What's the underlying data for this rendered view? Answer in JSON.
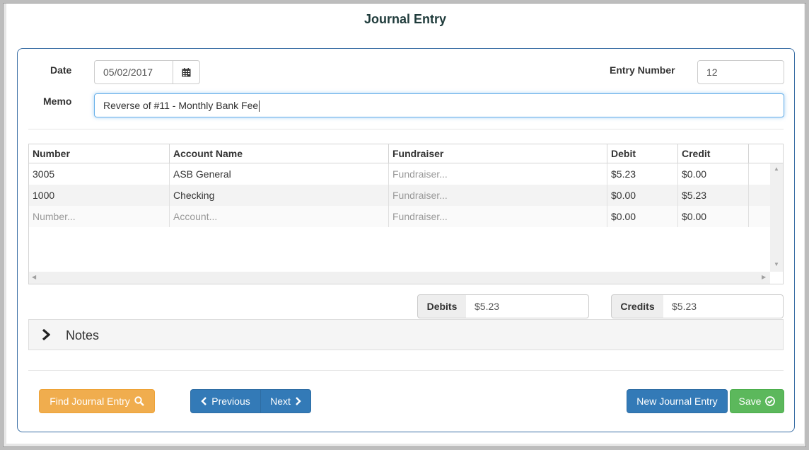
{
  "page": {
    "title": "Journal Entry"
  },
  "form": {
    "date_label": "Date",
    "date_value": "05/02/2017",
    "entry_number_label": "Entry Number",
    "entry_number_value": "12",
    "memo_label": "Memo",
    "memo_value": "Reverse of #11 - Monthly Bank Fee"
  },
  "grid": {
    "columns": [
      "Number",
      "Account Name",
      "Fundraiser",
      "Debit",
      "Credit"
    ],
    "rows": [
      {
        "number": "3005",
        "account": "ASB General",
        "fundraiser": "Fundraiser...",
        "debit": "$5.23",
        "credit": "$0.00"
      },
      {
        "number": "1000",
        "account": "Checking",
        "fundraiser": "Fundraiser...",
        "debit": "$0.00",
        "credit": "$5.23"
      },
      {
        "number": "Number...",
        "account": "Account...",
        "fundraiser": "Fundraiser...",
        "debit": "$0.00",
        "credit": "$0.00"
      }
    ]
  },
  "totals": {
    "debits_label": "Debits",
    "debits_value": "$5.23",
    "credits_label": "Credits",
    "credits_value": "$5.23"
  },
  "notes": {
    "label": "Notes"
  },
  "actions": {
    "find": "Find Journal Entry",
    "previous": "Previous",
    "next": "Next",
    "new": "New Journal Entry",
    "save": "Save"
  },
  "icons": {
    "calendar": "calendar-icon",
    "search": "search-icon",
    "chevron_left": "chevron-left-icon",
    "chevron_right": "chevron-right-icon",
    "check_circle": "check-circle-icon"
  },
  "colors": {
    "primary": "#337ab7",
    "warning": "#f0ad4e",
    "success": "#5cb85c",
    "panel_border": "#3a6ea5"
  }
}
